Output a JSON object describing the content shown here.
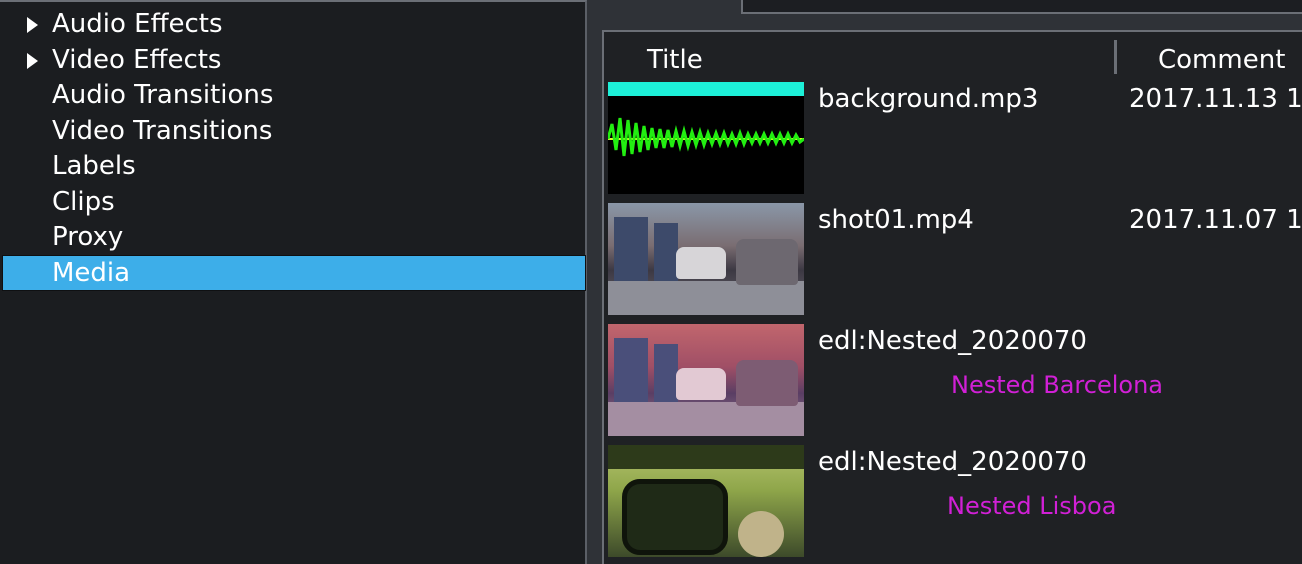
{
  "tree": {
    "items": [
      {
        "label": "Audio Effects",
        "expandable": true
      },
      {
        "label": "Video Effects",
        "expandable": true
      },
      {
        "label": "Audio Transitions",
        "expandable": false
      },
      {
        "label": "Video Transitions",
        "expandable": false
      },
      {
        "label": "Labels",
        "expandable": false
      },
      {
        "label": "Clips",
        "expandable": false
      },
      {
        "label": "Proxy",
        "expandable": false
      },
      {
        "label": "Media",
        "expandable": false,
        "selected": true
      }
    ]
  },
  "media_list": {
    "columns": {
      "title": "Title",
      "comment": "Comment"
    },
    "rows": [
      {
        "title": "background.mp3",
        "comment": "2017.11.13 1",
        "label": "",
        "thumb": "audio-waveform"
      },
      {
        "title": "shot01.mp4",
        "comment": "2017.11.07 1",
        "label": "",
        "thumb": "street-video"
      },
      {
        "title": "edl:Nested_2020070",
        "comment": "",
        "label": "Nested Barcelona",
        "thumb": "street-video-tinted"
      },
      {
        "title": "edl:Nested_2020070",
        "comment": "",
        "label": "Nested Lisboa",
        "thumb": "car-mirror-video"
      }
    ]
  },
  "colors": {
    "selection": "#3daee9",
    "label_text": "#d120d6",
    "waveform": "#22ee11",
    "audio_bar": "#1df0d8"
  }
}
